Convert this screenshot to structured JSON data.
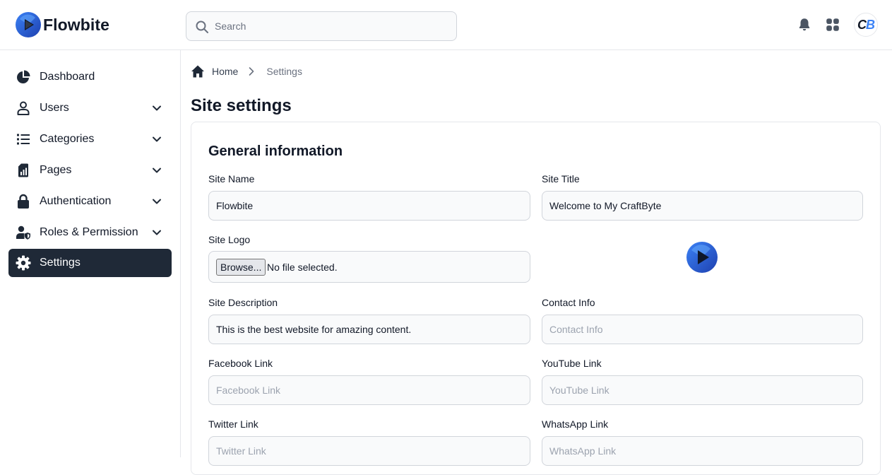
{
  "brand": {
    "name": "Flowbite"
  },
  "search": {
    "placeholder": "Search"
  },
  "user": {
    "initial_1": "C",
    "initial_2": "B"
  },
  "sidebar": {
    "items": [
      {
        "label": "Dashboard",
        "icon": "chart-pie-icon"
      },
      {
        "label": "Users",
        "icon": "user-icon"
      },
      {
        "label": "Categories",
        "icon": "list-icon"
      },
      {
        "label": "Pages",
        "icon": "file-chart-icon"
      },
      {
        "label": "Authentication",
        "icon": "lock-icon"
      },
      {
        "label": "Roles & Permission",
        "icon": "user-shield-icon"
      },
      {
        "label": "Settings",
        "icon": "gear-icon"
      }
    ]
  },
  "breadcrumb": {
    "home": "Home",
    "current": "Settings"
  },
  "page": {
    "title": "Site settings"
  },
  "form": {
    "section_title": "General information",
    "site_name": {
      "label": "Site Name",
      "value": "Flowbite"
    },
    "site_title": {
      "label": "Site Title",
      "value": "Welcome to My CraftByte"
    },
    "site_logo": {
      "label": "Site Logo",
      "browse_label": "Browse...",
      "status": "No file selected."
    },
    "site_description": {
      "label": "Site Description",
      "value": "This is the best website for amazing content."
    },
    "contact_info": {
      "label": "Contact Info",
      "placeholder": "Contact Info"
    },
    "facebook": {
      "label": "Facebook Link",
      "placeholder": "Facebook Link"
    },
    "youtube": {
      "label": "YouTube Link",
      "placeholder": "YouTube Link"
    },
    "twitter": {
      "label": "Twitter Link",
      "placeholder": "Twitter Link"
    },
    "whatsapp": {
      "label": "WhatsApp Link",
      "placeholder": "WhatsApp Link"
    }
  },
  "colors": {
    "brand_blue": "#1d4ed8",
    "sidebar_active": "#1f2937",
    "border": "#d1d5db",
    "input_bg": "#f9fafb"
  }
}
